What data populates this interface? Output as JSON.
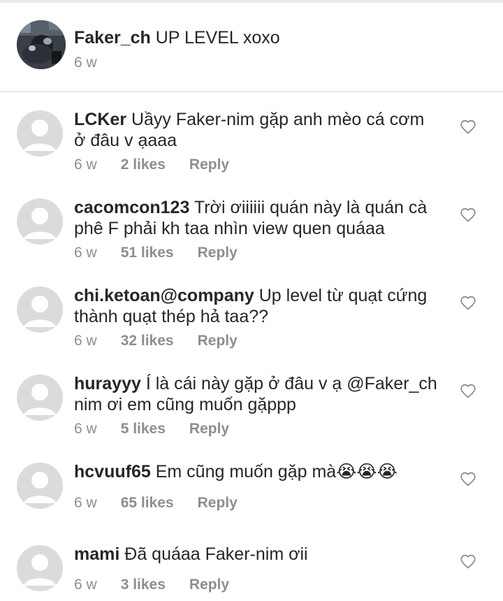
{
  "post": {
    "username": "Faker_ch",
    "text": "UP LEVEL xoxo",
    "time": "6 w"
  },
  "comments": [
    {
      "username": "LCKer",
      "text": "Uầyy Faker-nim gặp anh mèo cá cơm ở đâu v ạaaa",
      "time": "6 w",
      "likes": "2 likes",
      "reply": "Reply"
    },
    {
      "username": "cacomcon123",
      "text": "Trời ơiiiiii quán này là quán cà phê F phải kh taa nhìn view quen quáaa",
      "time": "6 w",
      "likes": "51 likes",
      "reply": "Reply"
    },
    {
      "username": "chi.ketoan@company",
      "text": "Up level từ quạt cứng thành quạt thép hả taa??",
      "time": "6 w",
      "likes": "32 likes",
      "reply": "Reply"
    },
    {
      "username": "hurayyy",
      "text": "Í là cái này gặp ở đâu v ạ @Faker_ch nim ơi em cũng muốn gặppp",
      "time": "6 w",
      "likes": "5 likes",
      "reply": "Reply"
    },
    {
      "username": "hcvuuf65",
      "text": "Em cũng muốn gặp mà",
      "time": "6 w",
      "likes": "65 likes",
      "reply": "Reply",
      "emoji": "😭😭😭"
    },
    {
      "username": "mami",
      "text": "Đã quáaa Faker-nim ơii",
      "time": "6 w",
      "likes": "3 likes",
      "reply": "Reply"
    }
  ],
  "icons": {
    "like": "heart-outline-icon",
    "avatar_placeholder": "default-avatar-icon"
  },
  "colors": {
    "text": "#262626",
    "secondary": "#8e8e8e",
    "avatar_placeholder": "#dbdbdb",
    "divider": "#e6e6e6"
  }
}
